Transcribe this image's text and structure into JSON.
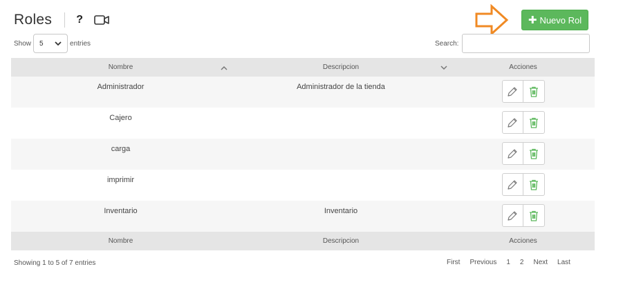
{
  "header": {
    "title": "Roles",
    "help_label": "?"
  },
  "toolbar": {
    "new_label": "Nuevo Rol",
    "new_icon": "plus-icon",
    "accent": "#5cb85c",
    "arrow_color": "#f08a24"
  },
  "length_menu": {
    "show_label": "Show",
    "value": "5",
    "entries_label": "entries"
  },
  "search": {
    "label": "Search:",
    "value": "",
    "placeholder": ""
  },
  "table": {
    "columns": [
      "Nombre",
      "Descripcion",
      "Acciones"
    ],
    "rows": [
      {
        "nombre": "Administrador",
        "descripcion": "Administrador de la tienda"
      },
      {
        "nombre": "Cajero",
        "descripcion": ""
      },
      {
        "nombre": "carga",
        "descripcion": ""
      },
      {
        "nombre": "imprimir",
        "descripcion": ""
      },
      {
        "nombre": "Inventario",
        "descripcion": "Inventario"
      }
    ],
    "footer_columns": [
      "Nombre",
      "Descripcion",
      "Acciones"
    ]
  },
  "info": "Showing 1 to 5 of 7 entries",
  "pagination": {
    "first": "First",
    "previous": "Previous",
    "pages": [
      "1",
      "2"
    ],
    "next": "Next",
    "last": "Last"
  },
  "icons": {
    "edit": "pencil-icon",
    "delete": "trash-icon",
    "delete_color": "#5cb85c"
  }
}
